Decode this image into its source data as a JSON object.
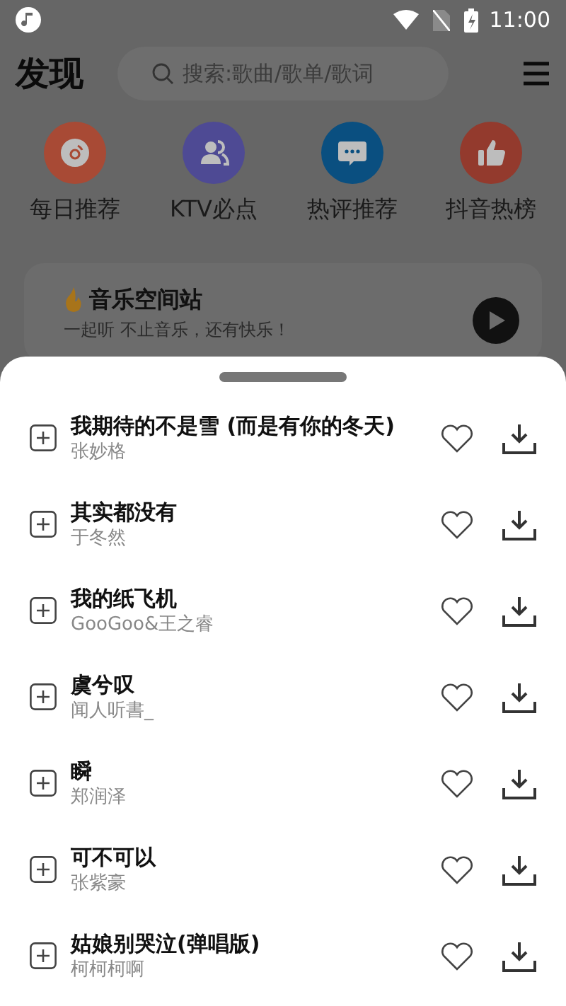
{
  "status_bar": {
    "time": "11:00"
  },
  "header": {
    "title": "发现",
    "search": {
      "placeholder": "搜索:歌曲/歌单/歌词"
    }
  },
  "shortcuts": [
    {
      "label": "每日推荐",
      "kind": "disc",
      "color": "#a84a35"
    },
    {
      "label": "KTV必点",
      "kind": "people",
      "color": "#4e4a94"
    },
    {
      "label": "热评推荐",
      "kind": "chat",
      "color": "#0a4f80"
    },
    {
      "label": "抖音热榜",
      "kind": "thumb",
      "color": "#933a2d"
    }
  ],
  "banner": {
    "title": "音乐空间站",
    "subtitle": "一起听 不止音乐，还有快乐！"
  },
  "songs": [
    {
      "title": "我期待的不是雪 (而是有你的冬天)",
      "artist": "张妙格"
    },
    {
      "title": "其实都没有",
      "artist": "于冬然"
    },
    {
      "title": "我的纸飞机",
      "artist": "GooGoo&王之睿"
    },
    {
      "title": "虞兮叹",
      "artist": "闻人听書_"
    },
    {
      "title": "瞬",
      "artist": "郑润泽"
    },
    {
      "title": "可不可以",
      "artist": "张紫豪"
    },
    {
      "title": "姑娘别哭泣(弹唱版)",
      "artist": "柯柯柯啊"
    }
  ]
}
